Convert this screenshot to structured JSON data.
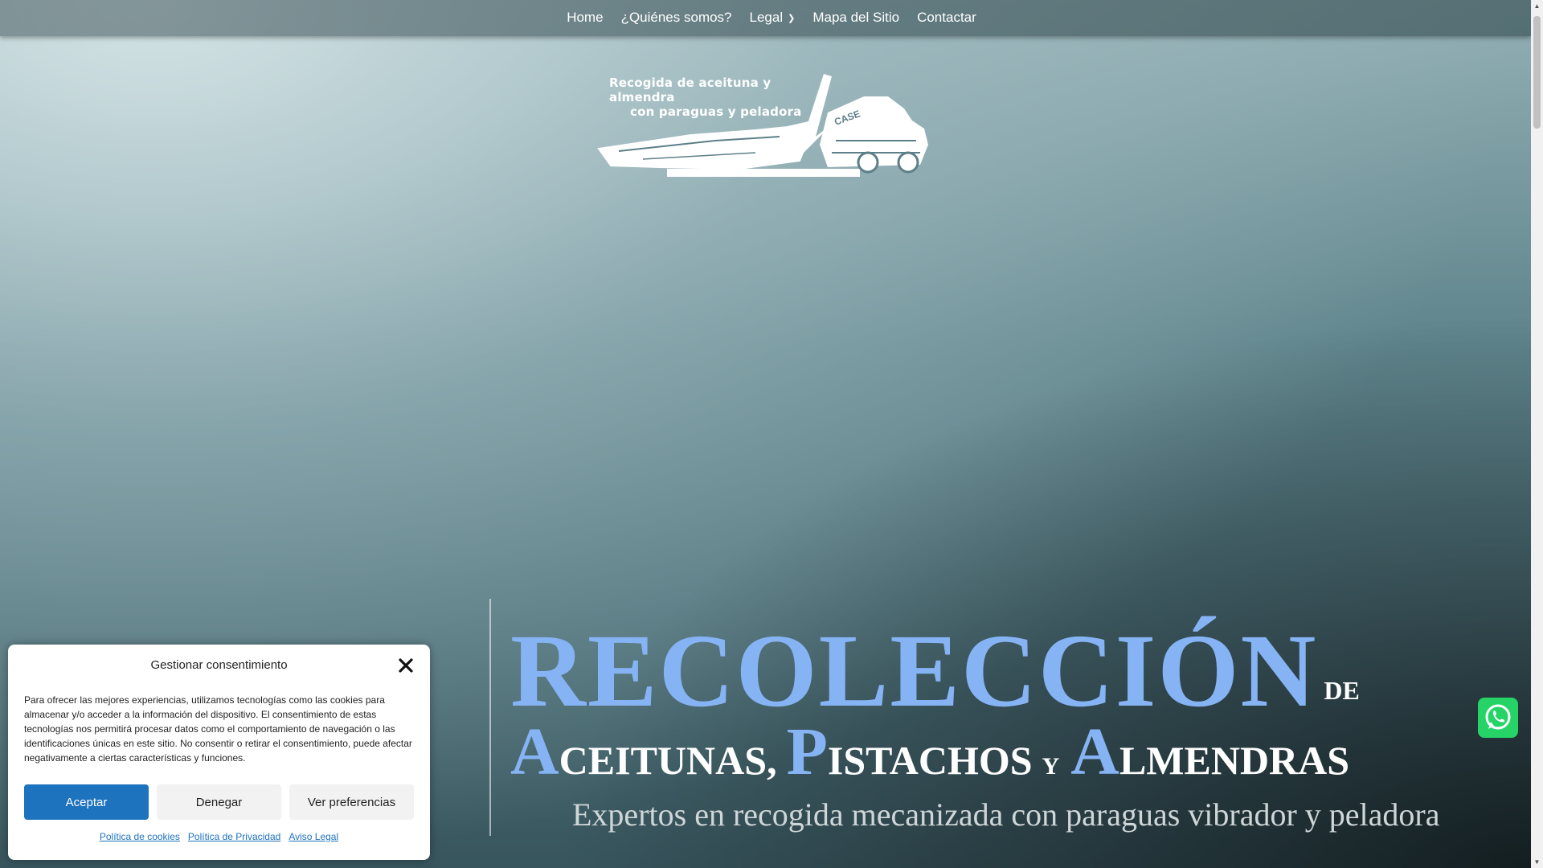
{
  "nav": {
    "items": [
      {
        "label": "Home"
      },
      {
        "label": "¿Quiénes somos?"
      },
      {
        "label": "Legal",
        "has_dropdown": true
      },
      {
        "label": "Mapa del Sitio"
      },
      {
        "label": "Contactar"
      }
    ]
  },
  "logo": {
    "line1": "Recogida de aceituna y almendra",
    "line2": "con paraguas y peladora",
    "machine_brand": "CASE"
  },
  "hero": {
    "headline_big": "RECOLECCIÓN",
    "headline_de": "DE",
    "word1_cap": "A",
    "word1_rest": "CEITUNAS,",
    "word2_cap": "P",
    "word2_rest": "ISTACHOS",
    "conj": "Y",
    "word3_cap": "A",
    "word3_rest": "LMENDRAS",
    "tagline": "Expertos en recogida mecanizada con paraguas vibrador y peladora",
    "accent_color": "#86b3f4"
  },
  "whatsapp": {
    "icon": "whatsapp-icon",
    "color": "#25d366"
  },
  "cookie": {
    "title": "Gestionar consentimiento",
    "body": "Para ofrecer las mejores experiencias, utilizamos tecnologías como las cookies para almacenar y/o acceder a la información del dispositivo. El consentimiento de estas tecnologías nos permitirá procesar datos como el comportamiento de navegación o las identificaciones únicas en este sitio. No consentir o retirar el consentimiento, puede afectar negativamente a ciertas características y funciones.",
    "accept_label": "Aceptar",
    "deny_label": "Denegar",
    "prefs_label": "Ver preferencias",
    "links": {
      "cookies": "Política de cookies",
      "privacy": "Política de Privacidad",
      "legal": "Aviso Legal"
    },
    "accent_color": "#1e73be"
  }
}
